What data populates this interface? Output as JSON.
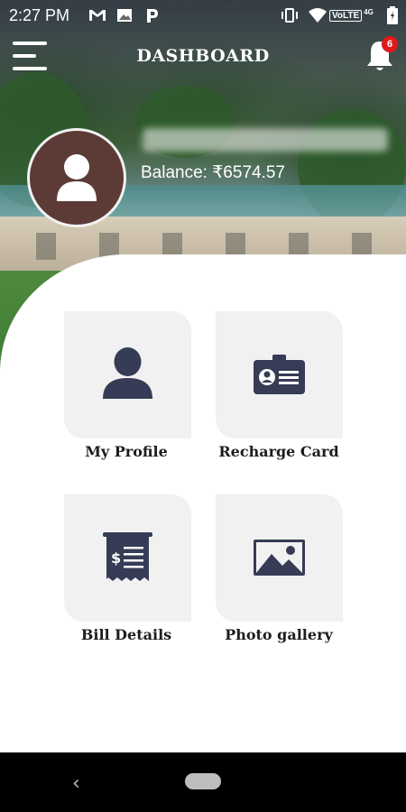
{
  "status_bar": {
    "time": "2:27 PM",
    "network_label": "VoLTE",
    "signal_label": "4G"
  },
  "header": {
    "title": "DASHBOARD",
    "notification_count": "6"
  },
  "profile": {
    "balance": "Balance: ₹6574.57"
  },
  "tiles": [
    {
      "label": "My Profile",
      "icon": "user-icon"
    },
    {
      "label": "Recharge Card",
      "icon": "id-card-icon"
    },
    {
      "label": "Bill Details",
      "icon": "bill-icon"
    },
    {
      "label": "Photo gallery",
      "icon": "image-icon"
    }
  ],
  "nav": {
    "back_glyph": "‹"
  },
  "colors": {
    "icon": "#363c55",
    "badge": "#e0191b",
    "tile_bg": "#f1f1f2",
    "avatar_bg": "#5c3b36"
  }
}
